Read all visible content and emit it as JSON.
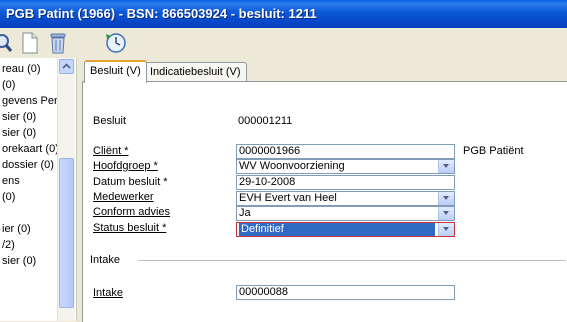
{
  "window": {
    "title": "PGB Patint (1966) - BSN: 866503924 - besluit: 1211"
  },
  "toolbar": {
    "icons": [
      "search-icon",
      "document-icon",
      "trash-icon",
      "refresh-clock-icon"
    ]
  },
  "tree": {
    "items": [
      "reau (0)",
      "(0)",
      "gevens Pers",
      "sier (0)",
      "sier (0)",
      "orekaart (0)",
      "dossier (0)",
      "ens",
      "(0)",
      "",
      "ier (0)",
      "/2)",
      "sier (0)"
    ]
  },
  "tabs": [
    {
      "label": "Besluit (V)",
      "active": true
    },
    {
      "label": "Indicatiebesluit (V)",
      "active": false
    }
  ],
  "form": {
    "besluit_label": "Besluit",
    "besluit_value": "000001211",
    "client_label": "Cliënt *",
    "client_value": "0000001966",
    "client_name": "PGB Patiënt",
    "hoofdgroep_label": "Hoofdgroep *",
    "hoofdgroep_value": "WV Woonvoorziening",
    "datum_label": "Datum besluit *",
    "datum_value": "29-10-2008",
    "medewerker_label": "Medewerker",
    "medewerker_value": "EVH Evert van Heel",
    "conform_label": "Conform advies",
    "conform_value": "Ja",
    "status_label": "Status besluit *",
    "status_value": "Definitief",
    "intake_section": "Intake",
    "intake_label": "Intake",
    "intake_value": "00000088"
  }
}
